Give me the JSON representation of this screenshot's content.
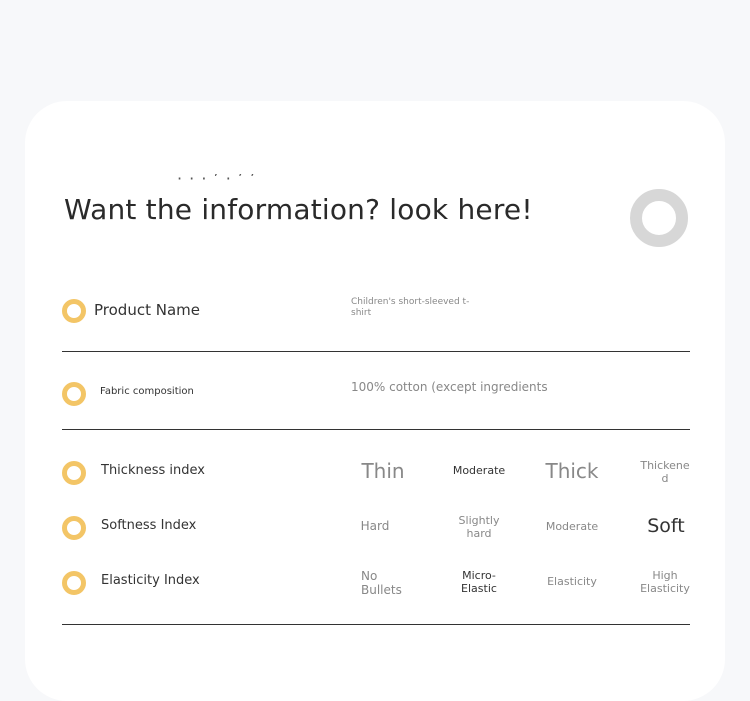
{
  "clipped_header": "·  ·  ·    ʼ  ·   ʼ ʼ",
  "headline": "Want the information? look here!",
  "rows": {
    "product_name": {
      "label": "Product Name",
      "value_line1": "Children's short-sleeved t-",
      "value_line2": "shirt"
    },
    "fabric": {
      "label": "Fabric composition",
      "value": "100% cotton (except ingredients"
    },
    "thickness": {
      "label": "Thickness index",
      "options": [
        "Thin",
        "Moderate",
        "Thick",
        "Thickene",
        "d"
      ]
    },
    "softness": {
      "label": "Softness Index",
      "options": [
        "Hard",
        "Slightly",
        "hard",
        "Moderate",
        "Soft"
      ]
    },
    "elasticity": {
      "label": "Elasticity Index",
      "options": [
        "No",
        "Bullets",
        "Micro-",
        "Elastic",
        "Elasticity",
        "High",
        "Elasticity"
      ]
    }
  },
  "colors": {
    "accent_ring": "#f3c566",
    "ring_grey": "#d7d7d7",
    "page_bg": "#f7f8fa"
  }
}
